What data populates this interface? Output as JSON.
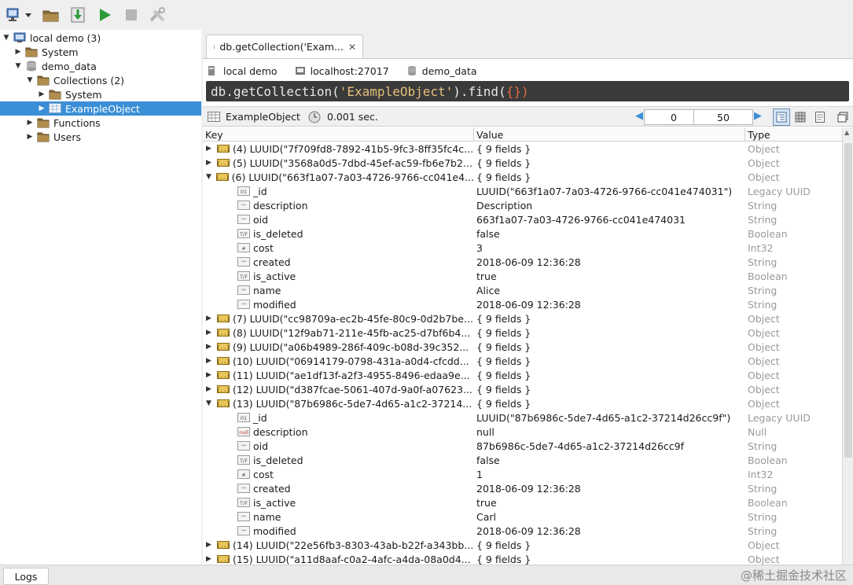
{
  "tree": [
    {
      "label": "local demo (3)",
      "depth": 0,
      "arrow": "down",
      "icon": "monitor-icon"
    },
    {
      "label": "System",
      "depth": 1,
      "arrow": "right",
      "icon": "folder-icon"
    },
    {
      "label": "demo_data",
      "depth": 1,
      "arrow": "down",
      "icon": "database-icon"
    },
    {
      "label": "Collections (2)",
      "depth": 2,
      "arrow": "down",
      "icon": "folder-icon"
    },
    {
      "label": "System",
      "depth": 3,
      "arrow": "right",
      "icon": "folder-icon"
    },
    {
      "label": "ExampleObject",
      "depth": 3,
      "arrow": "right",
      "icon": "table-icon",
      "selected": true
    },
    {
      "label": "Functions",
      "depth": 2,
      "arrow": "right",
      "icon": "folder-icon"
    },
    {
      "label": "Users",
      "depth": 2,
      "arrow": "right",
      "icon": "folder-icon"
    }
  ],
  "tab": {
    "label": "db.getCollection('Exam...",
    "close": "✕"
  },
  "infobar": {
    "connection": "local demo",
    "host": "localhost:27017",
    "database": "demo_data"
  },
  "query": {
    "prefix": "db.getCollection(",
    "string": "'ExampleObject'",
    "mid": ").find(",
    "braces": "{}",
    "suffix": ")"
  },
  "resbar": {
    "collection": "ExampleObject",
    "time": "0.001 sec.",
    "skip": "0",
    "limit": "50"
  },
  "columns": {
    "key": "Key",
    "value": "Value",
    "type": "Type"
  },
  "rows": [
    {
      "kind": "doc",
      "arrow": "right",
      "key": "(4) LUUID(\"7f709fd8-7892-41b5-9fc3-8ff35fc4c...",
      "value": "{ 9 fields }",
      "type": "Object"
    },
    {
      "kind": "doc",
      "arrow": "right",
      "key": "(5) LUUID(\"3568a0d5-7dbd-45ef-ac59-fb6e7b2...",
      "value": "{ 9 fields }",
      "type": "Object"
    },
    {
      "kind": "doc",
      "arrow": "down",
      "key": "(6) LUUID(\"663f1a07-7a03-4726-9766-cc041e4...",
      "value": "{ 9 fields }",
      "type": "Object"
    },
    {
      "kind": "field",
      "icon": "bin",
      "key": "_id",
      "value": "LUUID(\"663f1a07-7a03-4726-9766-cc041e474031\")",
      "type": "Legacy UUID"
    },
    {
      "kind": "field",
      "icon": "str",
      "key": "description",
      "value": "Description",
      "type": "String"
    },
    {
      "kind": "field",
      "icon": "str",
      "key": "oid",
      "value": "663f1a07-7a03-4726-9766-cc041e474031",
      "type": "String"
    },
    {
      "kind": "field",
      "icon": "bool",
      "key": "is_deleted",
      "value": "false",
      "type": "Boolean"
    },
    {
      "kind": "field",
      "icon": "num",
      "key": "cost",
      "value": "3",
      "type": "Int32"
    },
    {
      "kind": "field",
      "icon": "str",
      "key": "created",
      "value": "2018-06-09 12:36:28",
      "type": "String"
    },
    {
      "kind": "field",
      "icon": "bool",
      "key": "is_active",
      "value": "true",
      "type": "Boolean"
    },
    {
      "kind": "field",
      "icon": "str",
      "key": "name",
      "value": "Alice",
      "type": "String"
    },
    {
      "kind": "field",
      "icon": "str",
      "key": "modified",
      "value": "2018-06-09 12:36:28",
      "type": "String"
    },
    {
      "kind": "doc",
      "arrow": "right",
      "key": "(7) LUUID(\"cc98709a-ec2b-45fe-80c9-0d2b7be...",
      "value": "{ 9 fields }",
      "type": "Object"
    },
    {
      "kind": "doc",
      "arrow": "right",
      "key": "(8) LUUID(\"12f9ab71-211e-45fb-ac25-d7bf6b4...",
      "value": "{ 9 fields }",
      "type": "Object"
    },
    {
      "kind": "doc",
      "arrow": "right",
      "key": "(9) LUUID(\"a06b4989-286f-409c-b08d-39c352...",
      "value": "{ 9 fields }",
      "type": "Object"
    },
    {
      "kind": "doc",
      "arrow": "right",
      "key": "(10) LUUID(\"06914179-0798-431a-a0d4-cfcdd...",
      "value": "{ 9 fields }",
      "type": "Object"
    },
    {
      "kind": "doc",
      "arrow": "right",
      "key": "(11) LUUID(\"ae1df13f-a2f3-4955-8496-edaa9e...",
      "value": "{ 9 fields }",
      "type": "Object"
    },
    {
      "kind": "doc",
      "arrow": "right",
      "key": "(12) LUUID(\"d387fcae-5061-407d-9a0f-a07623...",
      "value": "{ 9 fields }",
      "type": "Object"
    },
    {
      "kind": "doc",
      "arrow": "down",
      "key": "(13) LUUID(\"87b6986c-5de7-4d65-a1c2-37214...",
      "value": "{ 9 fields }",
      "type": "Object"
    },
    {
      "kind": "field",
      "icon": "bin",
      "key": "_id",
      "value": "LUUID(\"87b6986c-5de7-4d65-a1c2-37214d26cc9f\")",
      "type": "Legacy UUID"
    },
    {
      "kind": "field",
      "icon": "null",
      "key": "description",
      "value": "null",
      "type": "Null"
    },
    {
      "kind": "field",
      "icon": "str",
      "key": "oid",
      "value": "87b6986c-5de7-4d65-a1c2-37214d26cc9f",
      "type": "String"
    },
    {
      "kind": "field",
      "icon": "bool",
      "key": "is_deleted",
      "value": "false",
      "type": "Boolean"
    },
    {
      "kind": "field",
      "icon": "num",
      "key": "cost",
      "value": "1",
      "type": "Int32"
    },
    {
      "kind": "field",
      "icon": "str",
      "key": "created",
      "value": "2018-06-09 12:36:28",
      "type": "String"
    },
    {
      "kind": "field",
      "icon": "bool",
      "key": "is_active",
      "value": "true",
      "type": "Boolean"
    },
    {
      "kind": "field",
      "icon": "str",
      "key": "name",
      "value": "Carl",
      "type": "String"
    },
    {
      "kind": "field",
      "icon": "str",
      "key": "modified",
      "value": "2018-06-09 12:36:28",
      "type": "String"
    },
    {
      "kind": "doc",
      "arrow": "right",
      "key": "(14) LUUID(\"22e56fb3-8303-43ab-b22f-a343bb...",
      "value": "{ 9 fields }",
      "type": "Object"
    },
    {
      "kind": "doc",
      "arrow": "right",
      "key": "(15) LUUID(\"a11d8aaf-c0a2-4afc-a4da-08a0d4...",
      "value": "{ 9 fields }",
      "type": "Object"
    }
  ],
  "icon_badges": {
    "bin": "01",
    "str": "\"\"",
    "bool": "T/F",
    "num": "#",
    "null": "null"
  },
  "status": {
    "logs": "Logs",
    "watermark": "@稀土掘金技术社区"
  },
  "colors": {
    "selection": "#3a8fd6",
    "query_bg": "#3a3a3a",
    "play": "#2e9a3a",
    "type_text": "#9a9a9a"
  }
}
